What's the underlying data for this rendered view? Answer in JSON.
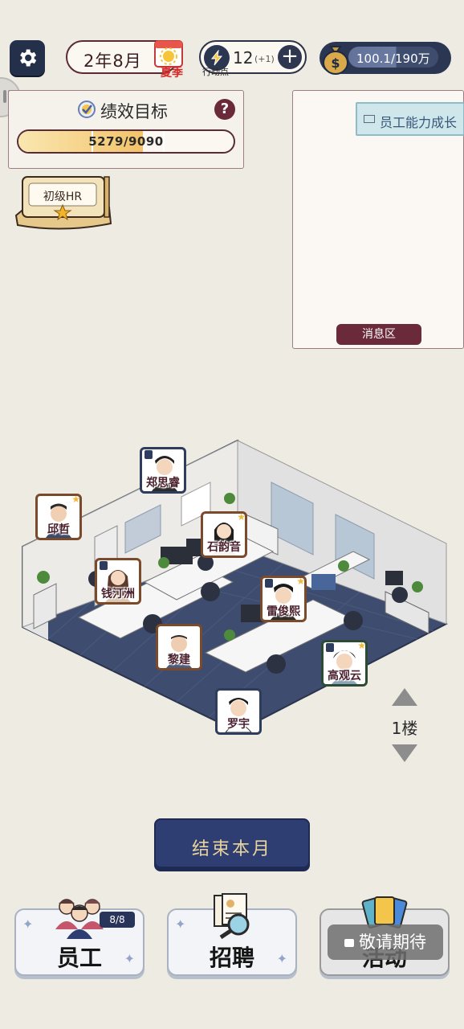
{
  "top": {
    "date": "2年8月",
    "season": "夏季",
    "action_points": "12",
    "action_points_inc": "(+1)",
    "action_points_label": "行动点",
    "money": "100.1/190万",
    "money_progress": 0.53
  },
  "performance": {
    "title": "绩效目标",
    "help": "?",
    "value": "5279/9090",
    "progress": 0.58
  },
  "rank": {
    "title": "初级HR"
  },
  "messages": {
    "items": [
      "员工能力成长"
    ],
    "zone_label": "消息区"
  },
  "employees": [
    {
      "name": "郑思睿",
      "badge": true,
      "star": false
    },
    {
      "name": "邱哲",
      "badge": false,
      "star": true
    },
    {
      "name": "石韵音",
      "badge": false,
      "star": true
    },
    {
      "name": "钱汀洲",
      "badge": true,
      "star": false
    },
    {
      "name": "雷俊熙",
      "badge": true,
      "star": true
    },
    {
      "name": "黎建",
      "badge": false,
      "star": false
    },
    {
      "name": "高观云",
      "badge": true,
      "star": true
    },
    {
      "name": "罗宇",
      "badge": false,
      "star": false
    }
  ],
  "floor": {
    "label": "1楼"
  },
  "end_month": {
    "label": "结束本月"
  },
  "bottom_nav": {
    "staff": {
      "label": "员工",
      "count": "8/8"
    },
    "recruit": {
      "label": "招聘"
    },
    "activity": {
      "label": "活动",
      "locked": "敬请期待"
    }
  }
}
